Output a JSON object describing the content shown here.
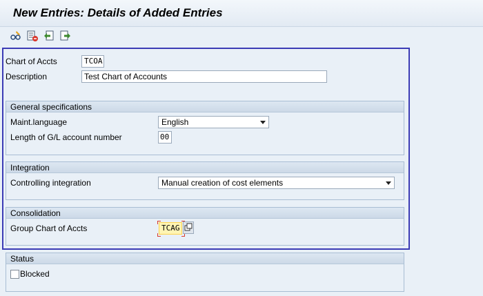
{
  "window": {
    "title": "New Entries: Details of Added Entries"
  },
  "toolbar": {
    "icons": [
      "glasses-edit-icon",
      "delete-row-icon",
      "previous-entry-icon",
      "next-entry-icon"
    ]
  },
  "header_fields": {
    "chart_label": "Chart of Accts",
    "chart_value": "TCOA",
    "desc_label": "Description",
    "desc_value": "Test Chart of Accounts"
  },
  "general": {
    "title": "General specifications",
    "lang_label": "Maint.language",
    "lang_value": "English",
    "len_label": "Length of G/L account number",
    "len_value": "00"
  },
  "integration": {
    "title": "Integration",
    "ci_label": "Controlling integration",
    "ci_value": "Manual creation of cost elements"
  },
  "consolidation": {
    "title": "Consolidation",
    "group_label": "Group Chart of Accts",
    "group_value": "TCAG"
  },
  "status": {
    "title": "Status",
    "blocked_label": "Blocked",
    "blocked_checked": false
  },
  "colors": {
    "selection_border": "#3b3bb5",
    "highlight": "#fff4b3"
  }
}
